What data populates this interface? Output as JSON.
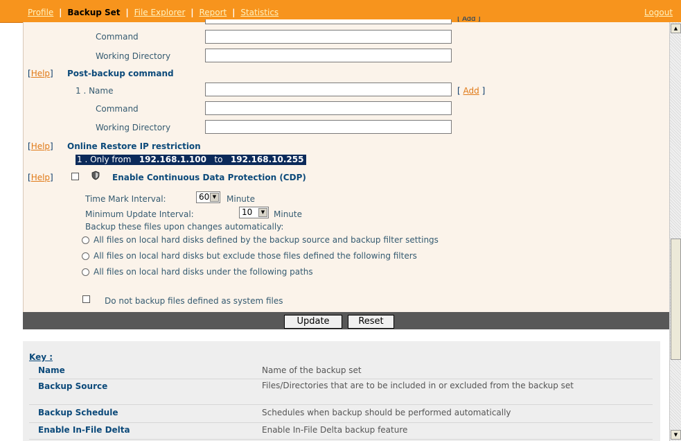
{
  "nav": {
    "items": [
      "Profile",
      "Backup Set",
      "File Explorer",
      "Report",
      "Statistics"
    ],
    "separator": "|",
    "logout": "Logout"
  },
  "pre_backup": {
    "add_fragment": "[ Add ]",
    "command_label": "Command",
    "workdir_label": "Working Directory"
  },
  "post_backup": {
    "help_open": "[",
    "help_text": "Help",
    "help_close": "]",
    "title": "Post-backup command",
    "name_label": "1 . Name",
    "add_open": "[",
    "add_text": "Add",
    "add_close": "]",
    "command_label": "Command",
    "workdir_label": "Working Directory",
    "name_value": "",
    "command_value": "",
    "workdir_value": ""
  },
  "ip_restriction": {
    "help_text": "Help",
    "title": "Online Restore IP restriction",
    "row_index": "1 .",
    "row_prefix": "Only from",
    "ip_from": "192.168.1.100",
    "to_word": "to",
    "ip_to": "192.168.10.255"
  },
  "cdp": {
    "help_text": "Help",
    "checked": false,
    "title": "Enable Continuous Data Protection (CDP)",
    "icon": "shield-icon",
    "time_mark_label": "Time Mark Interval:",
    "time_mark_value": "60",
    "time_mark_unit": "Minute",
    "min_update_label": "Minimum Update Interval:",
    "min_update_value": "10",
    "min_update_unit": "Minute",
    "backup_label": "Backup these files upon changes automatically:",
    "options": [
      "All files on local hard disks defined by the backup source and backup filter settings",
      "All files on local hard disks but exclude those files defined the following filters",
      "All files on local hard disks under the following paths"
    ],
    "system_files_label": "Do not backup files defined as system files"
  },
  "actions": {
    "update": "Update",
    "reset": "Reset"
  },
  "key": {
    "title": "Key :",
    "rows": [
      {
        "name": "Name",
        "desc": "Name of the backup set"
      },
      {
        "name": "Backup Source",
        "desc": "Files/Directories that are to be included in or excluded from the backup set"
      },
      {
        "name": "Backup Schedule",
        "desc": "Schedules when backup should be performed automatically"
      },
      {
        "name": "Enable In-File Delta",
        "desc": "Enable In-File Delta backup feature"
      }
    ]
  },
  "colors": {
    "accent": "#f7941d",
    "navy": "#0b2a5a",
    "panel": "#fbf3ea",
    "action_bar": "#585858"
  }
}
